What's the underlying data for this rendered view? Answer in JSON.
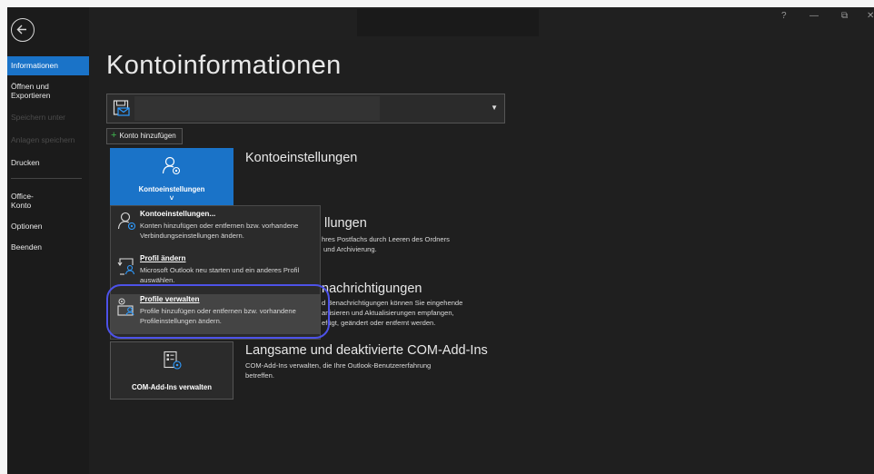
{
  "nav": {
    "items": [
      {
        "label": "Informationen",
        "state": "active"
      },
      {
        "label": "Öffnen und Exportieren",
        "state": "normal"
      },
      {
        "label": "Speichern unter",
        "state": "disabled"
      },
      {
        "label": "Anlagen speichern",
        "state": "disabled"
      },
      {
        "label": "Drucken",
        "state": "normal"
      },
      {
        "label": "Office-Konto",
        "state": "normal"
      },
      {
        "label": "Optionen",
        "state": "normal"
      },
      {
        "label": "Beenden",
        "state": "normal"
      }
    ]
  },
  "window_controls": {
    "help": "?",
    "minimize": "—",
    "restore": "⧉",
    "close": "✕"
  },
  "page": {
    "title": "Kontoinformationen"
  },
  "account": {
    "add_label": "Konto hinzufügen",
    "add_icon": "+"
  },
  "tiles": {
    "account_settings": {
      "label": "Kontoeinstellungen",
      "caret": "˅"
    },
    "com_addins": {
      "label": "COM-Add-Ins verwalten"
    }
  },
  "sections": {
    "account_settings": {
      "heading": "Kontoeinstellungen"
    },
    "cleanup": {
      "heading_partial": "llungen",
      "desc_line1": "hres Postfachs durch Leeren des Ordners",
      "desc_line2": "und Archivierung."
    },
    "rules": {
      "heading_partial": "nachrichtigungen",
      "desc_line1": "d Benachrichtigungen können Sie eingehende",
      "desc_line2": "anisieren und Aktualisierungen empfangen,",
      "desc_line3": "efügt, geändert oder entfernt werden."
    },
    "com": {
      "heading": "Langsame und deaktivierte COM-Add-Ins",
      "desc_line1": "COM-Add-Ins verwalten, die Ihre Outlook-Benutzererfahrung",
      "desc_line2": "betreffen."
    }
  },
  "menu": {
    "items": [
      {
        "title": "Kontoeinstellungen...",
        "desc": "Konten hinzufügen oder entfernen bzw. vorhandene Verbindungseinstellungen ändern."
      },
      {
        "title": "Profil ändern",
        "desc": "Microsoft Outlook neu starten und ein anderes Profil auswählen."
      },
      {
        "title": "Profile verwalten",
        "desc": "Profile hinzufügen oder entfernen bzw. vorhandene Profileinstellungen ändern."
      }
    ]
  },
  "colors": {
    "accent": "#1a73c8",
    "highlight_ring": "#4d52e8",
    "background": "#1f1f1f"
  }
}
